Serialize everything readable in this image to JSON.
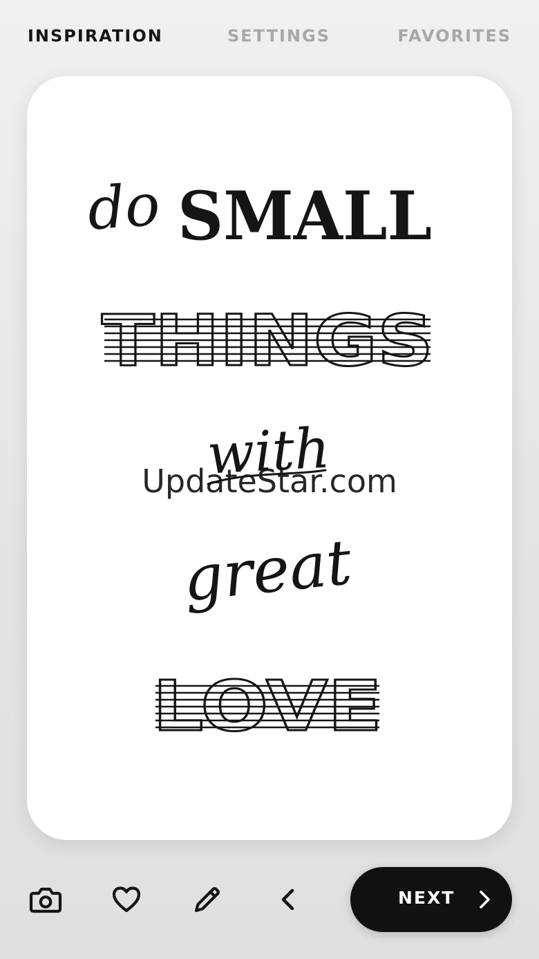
{
  "tabs": [
    {
      "label": "INSPIRATION",
      "active": true
    },
    {
      "label": "SETTINGS",
      "active": false
    },
    {
      "label": "FAVORITES",
      "active": false
    }
  ],
  "quote": {
    "words": [
      "do",
      "SMALL",
      "THINGS",
      "with",
      "great",
      "LOVE"
    ]
  },
  "watermark": "UpdateStar.com",
  "toolbar": {
    "icons": [
      "camera-icon",
      "heart-icon",
      "pencil-icon",
      "chevron-left-icon"
    ],
    "next_label": "NEXT"
  },
  "colors": {
    "background": "#e8e8e8",
    "card": "#ffffff",
    "text": "#151515",
    "inactive_tab": "#a8a8a8",
    "button": "#111111"
  }
}
